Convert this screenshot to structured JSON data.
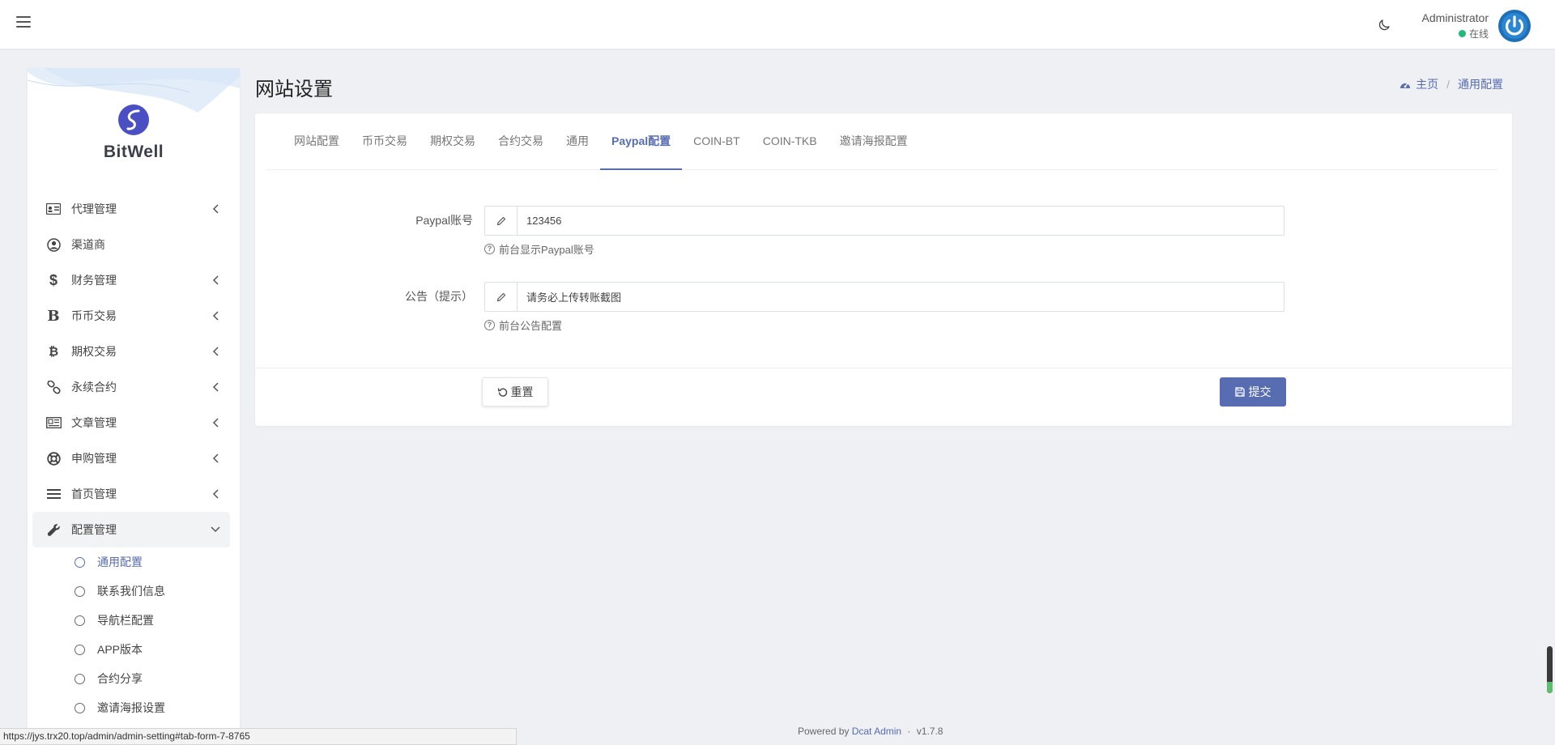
{
  "header": {
    "user_name": "Administrator",
    "user_status": "在线",
    "status_color": "#21b978"
  },
  "sidebar": {
    "brand": "BitWell",
    "menu": [
      {
        "label": "代理管理",
        "icon": "id-card-icon",
        "expandable": true
      },
      {
        "label": "渠道商",
        "icon": "user-circle-icon",
        "expandable": false
      },
      {
        "label": "财务管理",
        "icon": "dollar-icon",
        "expandable": true
      },
      {
        "label": "币币交易",
        "icon": "bitcoin-b-icon",
        "expandable": true
      },
      {
        "label": "期权交易",
        "icon": "bitcoin-icon",
        "expandable": true
      },
      {
        "label": "永续合约",
        "icon": "link-icon",
        "expandable": true
      },
      {
        "label": "文章管理",
        "icon": "newspaper-icon",
        "expandable": true
      },
      {
        "label": "申购管理",
        "icon": "life-ring-icon",
        "expandable": true
      },
      {
        "label": "首页管理",
        "icon": "list-icon",
        "expandable": true
      },
      {
        "label": "配置管理",
        "icon": "wrench-icon",
        "expandable": true,
        "expanded": true
      }
    ],
    "submenu": [
      {
        "label": "通用配置",
        "current": true
      },
      {
        "label": "联系我们信息",
        "current": false
      },
      {
        "label": "导航栏配置",
        "current": false
      },
      {
        "label": "APP版本",
        "current": false
      },
      {
        "label": "合约分享",
        "current": false
      },
      {
        "label": "邀请海报设置",
        "current": false
      }
    ]
  },
  "page": {
    "title": "网站设置",
    "breadcrumb_home": "主页",
    "breadcrumb_current": "通用配置"
  },
  "tabs": [
    "网站配置",
    "币币交易",
    "期权交易",
    "合约交易",
    "通用",
    "Paypal配置",
    "COIN-BT",
    "COIN-TKB",
    "邀请海报配置"
  ],
  "active_tab": "Paypal配置",
  "form": {
    "paypal_label": "Paypal账号",
    "paypal_value": "123456",
    "paypal_help": "前台显示Paypal账号",
    "notice_label": "公告（提示）",
    "notice_value": "请务必上传转账截图",
    "notice_help": "前台公告配置"
  },
  "buttons": {
    "reset": "重置",
    "submit": "提交"
  },
  "footer": {
    "powered_prefix": "Powered by",
    "powered_link": "Dcat Admin",
    "separator": "·",
    "version": "v1.7.8"
  },
  "statusbar_url": "https://jys.trx20.top/admin/admin-setting#tab-form-7-8765",
  "colors": {
    "accent": "#586cb1",
    "background": "#eef0f4"
  }
}
